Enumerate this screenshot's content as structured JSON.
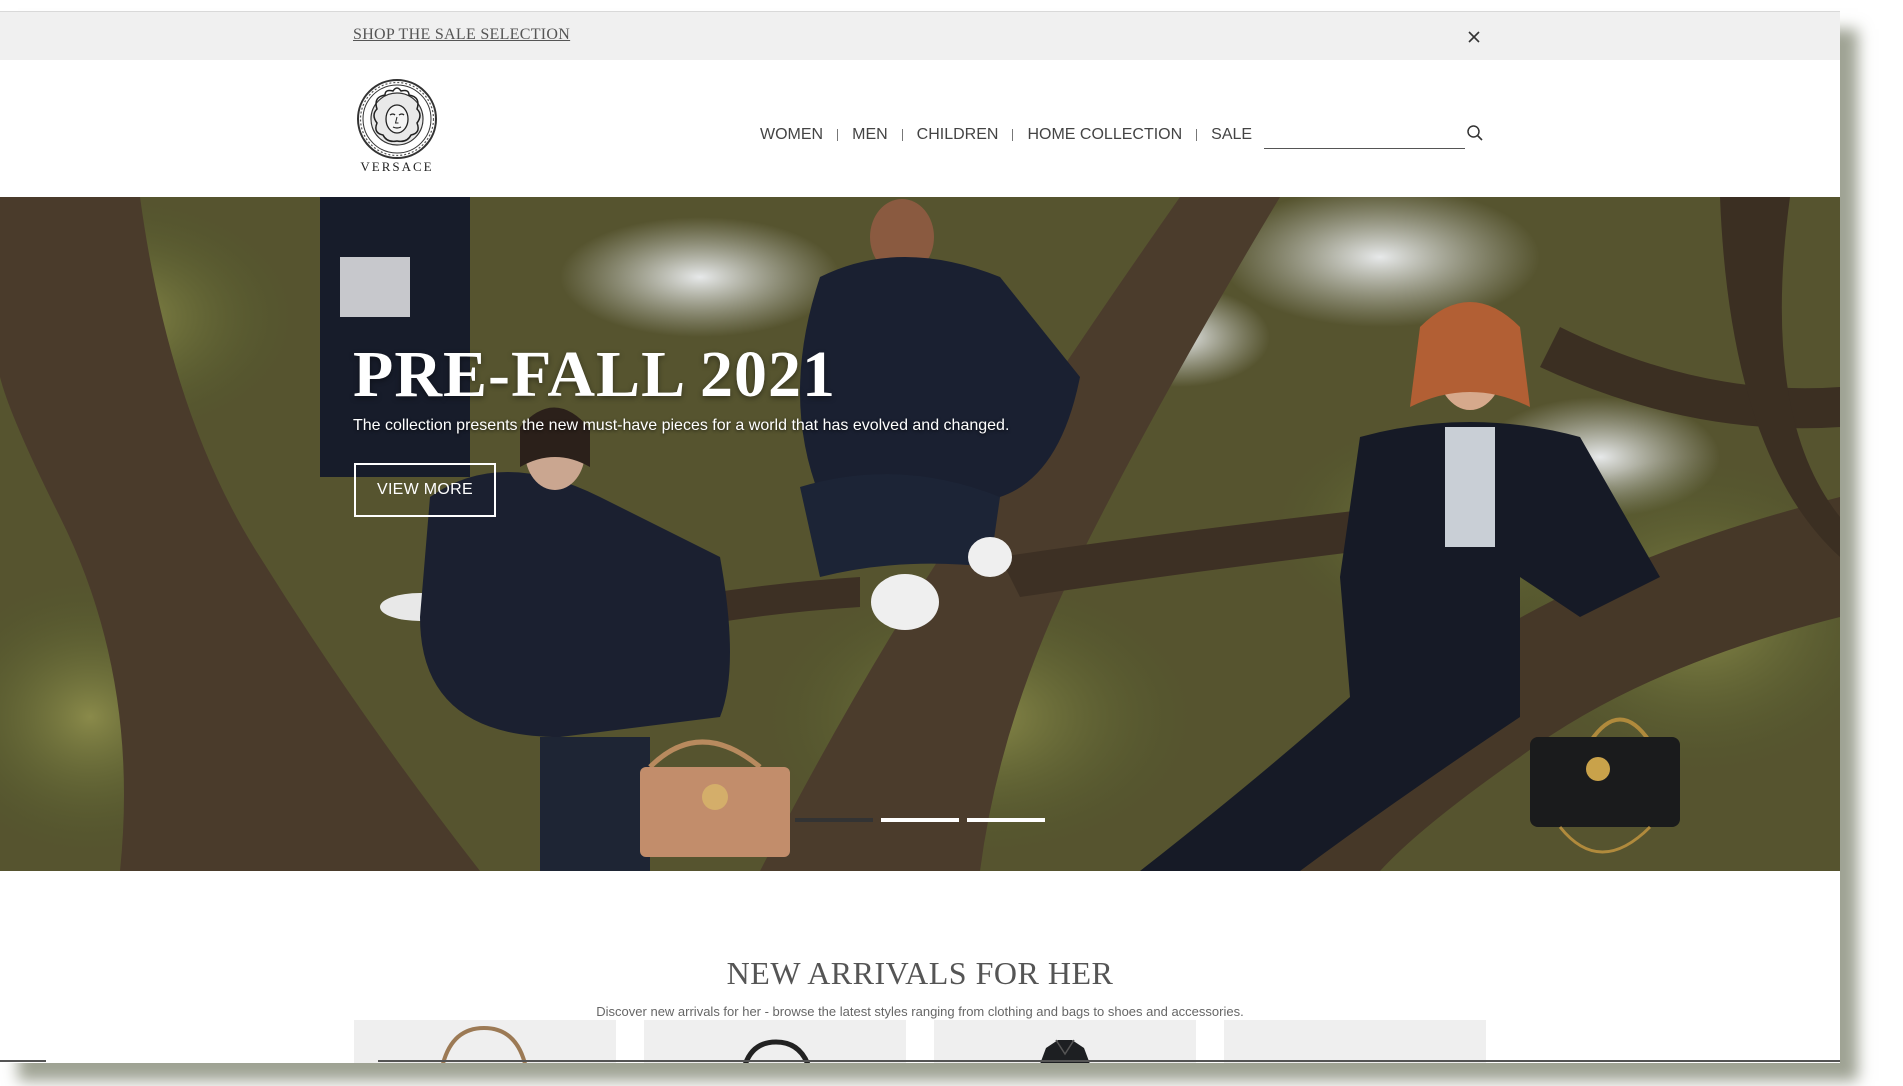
{
  "promo": {
    "link_text": "SHOP THE SALE SELECTION",
    "close_icon": "close-icon"
  },
  "header": {
    "logo_icon": "medusa-logo-icon",
    "logo_text": "VERSACE",
    "nav": [
      "WOMEN",
      "MEN",
      "CHILDREN",
      "HOME COLLECTION",
      "SALE"
    ],
    "search": {
      "value": "",
      "placeholder": "",
      "icon": "search-icon"
    }
  },
  "hero": {
    "title": "PRE-FALL 2021",
    "subtitle": "The collection presents the new must-have pieces for a world that has evolved and changed.",
    "button_label": "VIEW MORE",
    "slide_count": 3,
    "active_slide": 1
  },
  "arrivals": {
    "title": "NEW ARRIVALS FOR HER",
    "subtitle": "Discover new arrivals for her - browse the latest styles ranging from clothing and bags to shoes and accessories.",
    "products": [
      {
        "type": "bag-icon"
      },
      {
        "type": "bag-icon"
      },
      {
        "type": "jacket-icon"
      },
      {
        "type": "blank"
      }
    ]
  },
  "colors": {
    "promo_bg": "#f0f0f0",
    "text_gray": "#555555",
    "hero_text": "#ffffff",
    "card_bg": "#efefef"
  }
}
